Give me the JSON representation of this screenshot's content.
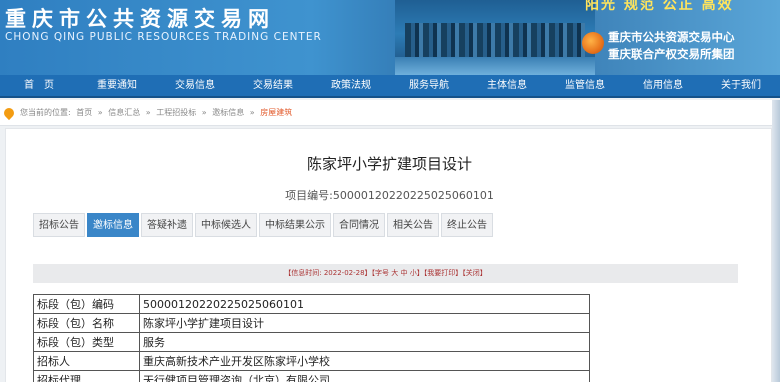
{
  "header": {
    "title_cn": "重庆市公共资源交易网",
    "title_en": "CHONG QING PUBLIC RESOURCES TRADING CENTER",
    "slogan": "阳光  规范  公正  高效",
    "org_line1": "重庆市公共资源交易中心",
    "org_line2": "重庆联合产权交易所集团"
  },
  "nav": [
    {
      "label": "首　页"
    },
    {
      "label": "重要通知"
    },
    {
      "label": "交易信息"
    },
    {
      "label": "交易结果"
    },
    {
      "label": "政策法规"
    },
    {
      "label": "服务导航"
    },
    {
      "label": "主体信息"
    },
    {
      "label": "监管信息"
    },
    {
      "label": "信用信息"
    },
    {
      "label": "关于我们"
    }
  ],
  "breadcrumb": {
    "prefix": "您当前的位置:",
    "items": [
      "首页",
      "信息汇总",
      "工程招投标",
      "邀标信息"
    ],
    "current": "房屋建筑",
    "sep": "»"
  },
  "project": {
    "title": "陈家坪小学扩建项目设计",
    "number_label": "项目编号:",
    "number": "500001202202250250601​01"
  },
  "tabs": [
    {
      "label": "招标公告",
      "active": false
    },
    {
      "label": "邀标信息",
      "active": true
    },
    {
      "label": "答疑补遗",
      "active": false
    },
    {
      "label": "中标候选人",
      "active": false
    },
    {
      "label": "中标结果公示",
      "active": false
    },
    {
      "label": "合同情况",
      "active": false
    },
    {
      "label": "相关公告",
      "active": false
    },
    {
      "label": "终止公告",
      "active": false
    }
  ],
  "infobar": "【信息时间: 2022-02-28】【字号 大 中 小】【我要打印】【关闭】",
  "table": [
    {
      "key": "标段（包）编码",
      "value": "5000012022022502506010​1"
    },
    {
      "key": "标段（包）名称",
      "value": "陈家坪小学扩建项目设计"
    },
    {
      "key": "标段（包）类型",
      "value": "服务"
    },
    {
      "key": "招标人",
      "value": "重庆高新技术产业开发区陈家坪小学校"
    },
    {
      "key": "招标代理",
      "value": "天行健项目管理咨询（北京）有限公司"
    }
  ]
}
